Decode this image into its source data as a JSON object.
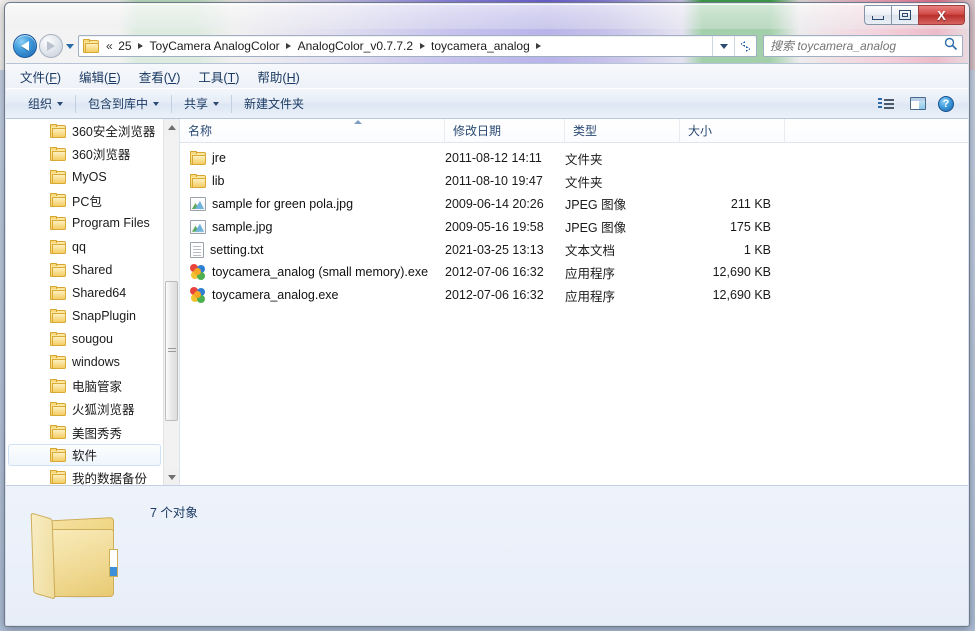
{
  "window": {
    "controls": {
      "minimize": "—",
      "maximize": "□",
      "close": "X"
    }
  },
  "addressbar": {
    "back_tooltip": "后退",
    "forward_tooltip": "前进",
    "crumbs": [
      "«",
      "25",
      "ToyCamera AnalogColor",
      "AnalogColor_v0.7.7.2",
      "toycamera_analog"
    ],
    "refresh_glyph": "↻"
  },
  "search": {
    "placeholder": "搜索 toycamera_analog",
    "value": "",
    "icon": "search-icon"
  },
  "menubar": {
    "items": [
      {
        "label": "文件",
        "accel": "F"
      },
      {
        "label": "编辑",
        "accel": "E"
      },
      {
        "label": "查看",
        "accel": "V"
      },
      {
        "label": "工具",
        "accel": "T"
      },
      {
        "label": "帮助",
        "accel": "H"
      }
    ]
  },
  "commandbar": {
    "organize": "组织",
    "include_in_library": "包含到库中",
    "share": "共享",
    "new_folder": "新建文件夹",
    "help_glyph": "?"
  },
  "navpane": {
    "items": [
      {
        "label": "360安全浏览器",
        "hover": false
      },
      {
        "label": "360浏览器",
        "hover": false
      },
      {
        "label": "MyOS",
        "hover": false
      },
      {
        "label": "PC包",
        "hover": false
      },
      {
        "label": "Program Files",
        "hover": false
      },
      {
        "label": "qq",
        "hover": false
      },
      {
        "label": "Shared",
        "hover": false
      },
      {
        "label": "Shared64",
        "hover": false
      },
      {
        "label": "SnapPlugin",
        "hover": false
      },
      {
        "label": "sougou",
        "hover": false
      },
      {
        "label": "windows",
        "hover": false
      },
      {
        "label": "电脑管家",
        "hover": false
      },
      {
        "label": "火狐浏览器",
        "hover": false
      },
      {
        "label": "美图秀秀",
        "hover": false
      },
      {
        "label": "软件",
        "hover": true
      },
      {
        "label": "我的数据备份",
        "hover": false
      }
    ]
  },
  "filelist": {
    "columns": [
      {
        "key": "name",
        "label": "名称",
        "sorted": "asc"
      },
      {
        "key": "date",
        "label": "修改日期"
      },
      {
        "key": "type",
        "label": "类型"
      },
      {
        "key": "size",
        "label": "大小"
      }
    ],
    "rows": [
      {
        "icon": "folder-icon",
        "name": "jre",
        "date": "2011-08-12 14:11",
        "type": "文件夹",
        "size": ""
      },
      {
        "icon": "folder-icon",
        "name": "lib",
        "date": "2011-08-10 19:47",
        "type": "文件夹",
        "size": ""
      },
      {
        "icon": "image-icon",
        "name": "sample for green pola.jpg",
        "date": "2009-06-14 20:26",
        "type": "JPEG 图像",
        "size": "211 KB"
      },
      {
        "icon": "image-icon",
        "name": "sample.jpg",
        "date": "2009-05-16 19:58",
        "type": "JPEG 图像",
        "size": "175 KB"
      },
      {
        "icon": "text-icon",
        "name": "setting.txt",
        "date": "2021-03-25 13:13",
        "type": "文本文档",
        "size": "1 KB"
      },
      {
        "icon": "exe-icon",
        "name": "toycamera_analog (small memory).exe",
        "date": "2012-07-06 16:32",
        "type": "应用程序",
        "size": "12,690 KB"
      },
      {
        "icon": "exe-icon",
        "name": "toycamera_analog.exe",
        "date": "2012-07-06 16:32",
        "type": "应用程序",
        "size": "12,690 KB"
      }
    ]
  },
  "details": {
    "item_count": "7 个对象",
    "icon": "large-folder-icon"
  }
}
